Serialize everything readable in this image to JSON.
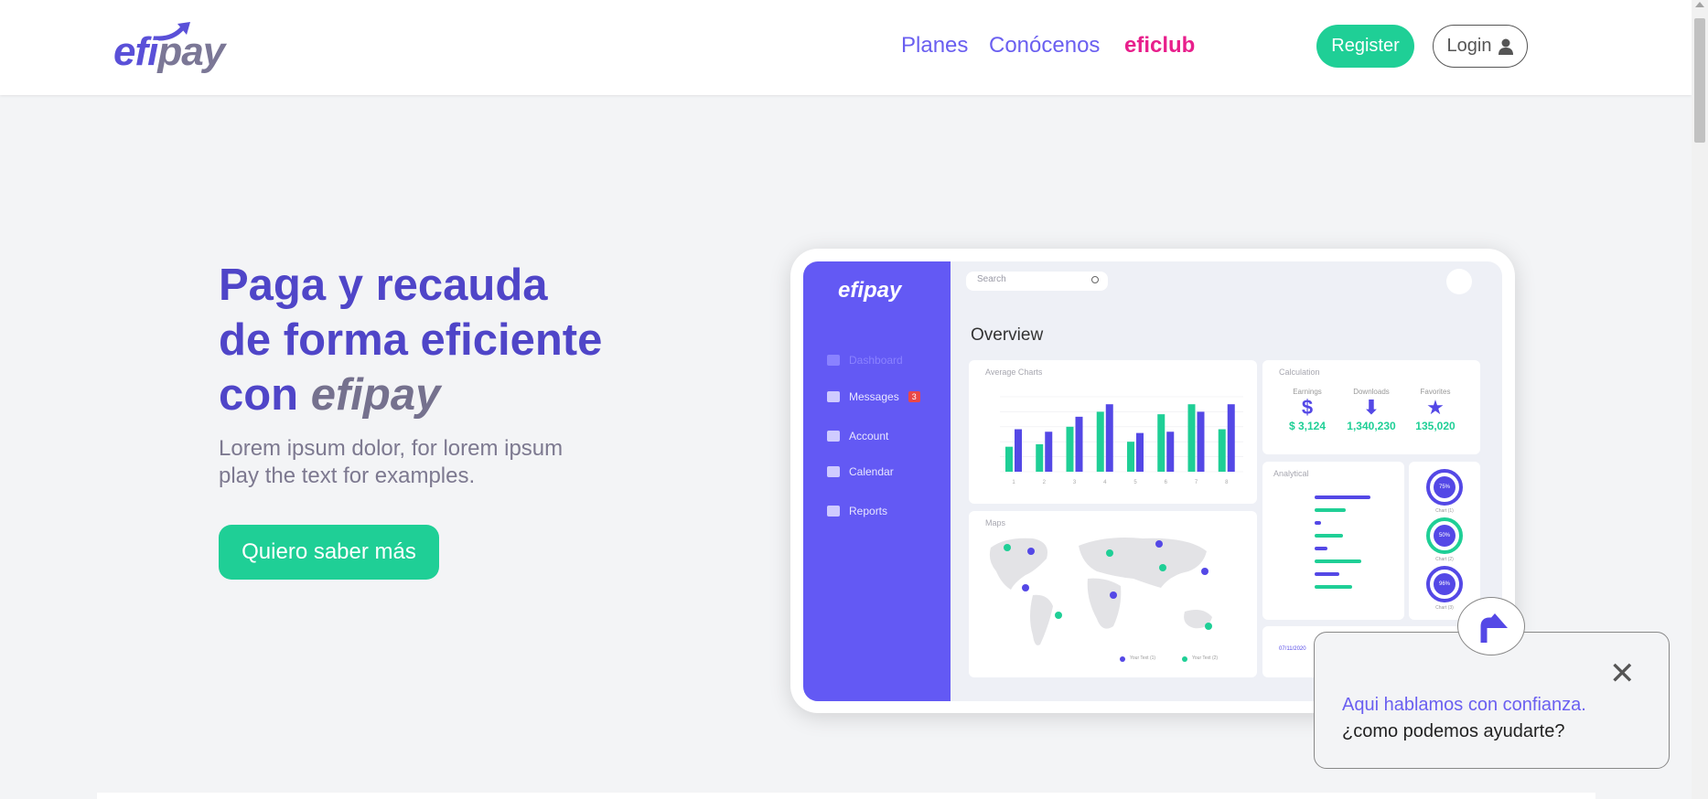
{
  "header": {
    "logo_part1": "efi",
    "logo_part2": "pay",
    "nav": [
      {
        "label": "Planes"
      },
      {
        "label": "Conócenos"
      },
      {
        "label": "eficlub"
      }
    ],
    "register_label": "Register",
    "login_label": "Login"
  },
  "hero": {
    "title_line1": "Paga y recauda",
    "title_line2": "de forma eficiente",
    "title_line3_prefix": "con ",
    "title_line3_brand": "efipay",
    "subtitle": "Lorem ipsum dolor, for lorem ipsum play the text for examples.",
    "cta_label": "Quiero saber más"
  },
  "mockup": {
    "logo": "efipay",
    "sidebar": [
      {
        "label": "Dashboard"
      },
      {
        "label": "Messages",
        "badge": "3"
      },
      {
        "label": "Account"
      },
      {
        "label": "Calendar"
      },
      {
        "label": "Reports"
      }
    ],
    "search_placeholder": "Search",
    "overview_title": "Overview",
    "charts_title": "Average Charts",
    "calc_title": "Calculation",
    "calc": [
      {
        "label": "Earnings",
        "icon": "dollar-icon",
        "value": "$ 3,124"
      },
      {
        "label": "Downloads",
        "icon": "download-arrow-icon",
        "value": "1,340,230"
      },
      {
        "label": "Favorites",
        "icon": "star-icon",
        "value": "135,020"
      }
    ],
    "maps_title": "Maps",
    "map_legend": [
      "Your Text (1)",
      "Your Text (2)"
    ],
    "analytical_title": "Analytical",
    "analytical": [
      {
        "pct": 0.9
      },
      {
        "pct": 0.5
      },
      {
        "pct": 0.1
      },
      {
        "pct": 0.45
      },
      {
        "pct": 0.2
      },
      {
        "pct": 0.75
      },
      {
        "pct": 0.4
      },
      {
        "pct": 0.6
      }
    ],
    "rings": [
      {
        "value": "75%",
        "label": "Chart (1)"
      },
      {
        "value": "50%",
        "label": "Chart (2)"
      },
      {
        "value": "96%",
        "label": "Chart (3)"
      }
    ],
    "date": "07/11/2020"
  },
  "chart_data": {
    "type": "bar",
    "categories": [
      "1",
      "2",
      "3",
      "4",
      "5",
      "6",
      "7",
      "8"
    ],
    "series": [
      {
        "values": [
          1000,
          1100,
          1800,
          2400,
          1200,
          2300,
          2700,
          1700
        ]
      },
      {
        "values": [
          1700,
          1600,
          2200,
          2700,
          1550,
          1600,
          2400,
          2700
        ]
      }
    ],
    "ylim": [
      0,
      3000
    ],
    "colors": [
      "#1fcf96",
      "#5448e6"
    ]
  },
  "chat": {
    "line1": "Aqui hablamos con confianza.",
    "line2": "¿como podemos ayudarte?"
  },
  "colors": {
    "brand_purple": "#5448e6",
    "brand_green": "#1fcf96",
    "eficlub_pink": "#e81f8c"
  }
}
